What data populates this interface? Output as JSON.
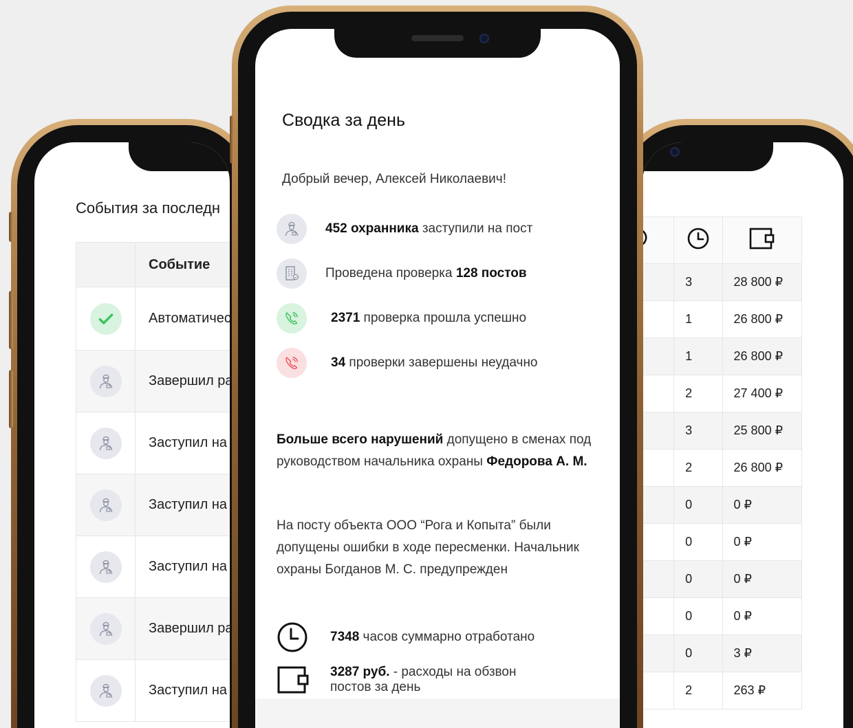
{
  "left_screen": {
    "title": "События за последн",
    "table": {
      "header": [
        "",
        "Событие"
      ],
      "rows": [
        {
          "icon": "check-icon",
          "text": "Автоматичес"
        },
        {
          "icon": "guard-icon",
          "text": "Завершил ра"
        },
        {
          "icon": "guard-icon",
          "text": "Заступил на"
        },
        {
          "icon": "guard-icon",
          "text": "Заступил на"
        },
        {
          "icon": "guard-icon",
          "text": "Заступил на"
        },
        {
          "icon": "guard-icon",
          "text": "Завершил ра"
        },
        {
          "icon": "guard-icon",
          "text": "Заступил на"
        }
      ]
    }
  },
  "center_screen": {
    "title": "Сводка за день",
    "greeting": "Добрый вечер, Алексей Николаевич!",
    "stats": [
      {
        "icon": "guard-icon",
        "bold": "452 охранника",
        "text": " заступили на пост"
      },
      {
        "icon": "building-icon",
        "prefix": "Проведена проверка ",
        "bold": "128 постов"
      },
      {
        "icon": "phone-call-success-icon",
        "bold": "2371",
        "text": " проверка прошла успешно"
      },
      {
        "icon": "phone-call-failed-icon",
        "bold": "34",
        "text": " проверки завершены неудачно"
      }
    ],
    "violations": {
      "bold_lead": "Больше всего нарушений",
      "text": " допущено в сменах под руководством начальника охраны ",
      "bold_name": "Федорова А. М."
    },
    "post_note": "На посту объекта ООО “Рога и Копыта” были допущены ошибки в ходе пересменки. Начальник охраны Богданов М. С. предупрежден",
    "hours": {
      "icon": "clock-icon",
      "bold": "7348",
      "text": " часов суммарно отработано"
    },
    "costs": {
      "icon": "wallet-icon",
      "bold": "3287 руб.",
      "text_line1": " - расходы на обзвон",
      "text_line2": "постов за день"
    }
  },
  "right_screen": {
    "header_icons": [
      "refresh-icon",
      "clock-icon",
      "wallet-icon"
    ],
    "rows": [
      {
        "hours": "3",
        "cost": "28 800 ₽"
      },
      {
        "hours": "1",
        "cost": "26 800 ₽"
      },
      {
        "hours": "1",
        "cost": "26 800 ₽"
      },
      {
        "hours": "2",
        "cost": "27 400 ₽"
      },
      {
        "hours": "3",
        "cost": "25 800 ₽"
      },
      {
        "hours": "2",
        "cost": "26 800 ₽"
      },
      {
        "hours": "0",
        "cost": "0 ₽"
      },
      {
        "hours": "0",
        "cost": "0 ₽"
      },
      {
        "hours": "0",
        "cost": "0 ₽"
      },
      {
        "hours": "0",
        "cost": "0 ₽"
      },
      {
        "hours": "0",
        "cost": "3 ₽"
      },
      {
        "hours": "2",
        "cost": "263 ₽"
      }
    ]
  },
  "colors": {
    "success_green": "#3cc35c",
    "fail_red": "#e9565c",
    "gold_frame": "#b68650",
    "icon_circle": "#e6e8ee"
  }
}
